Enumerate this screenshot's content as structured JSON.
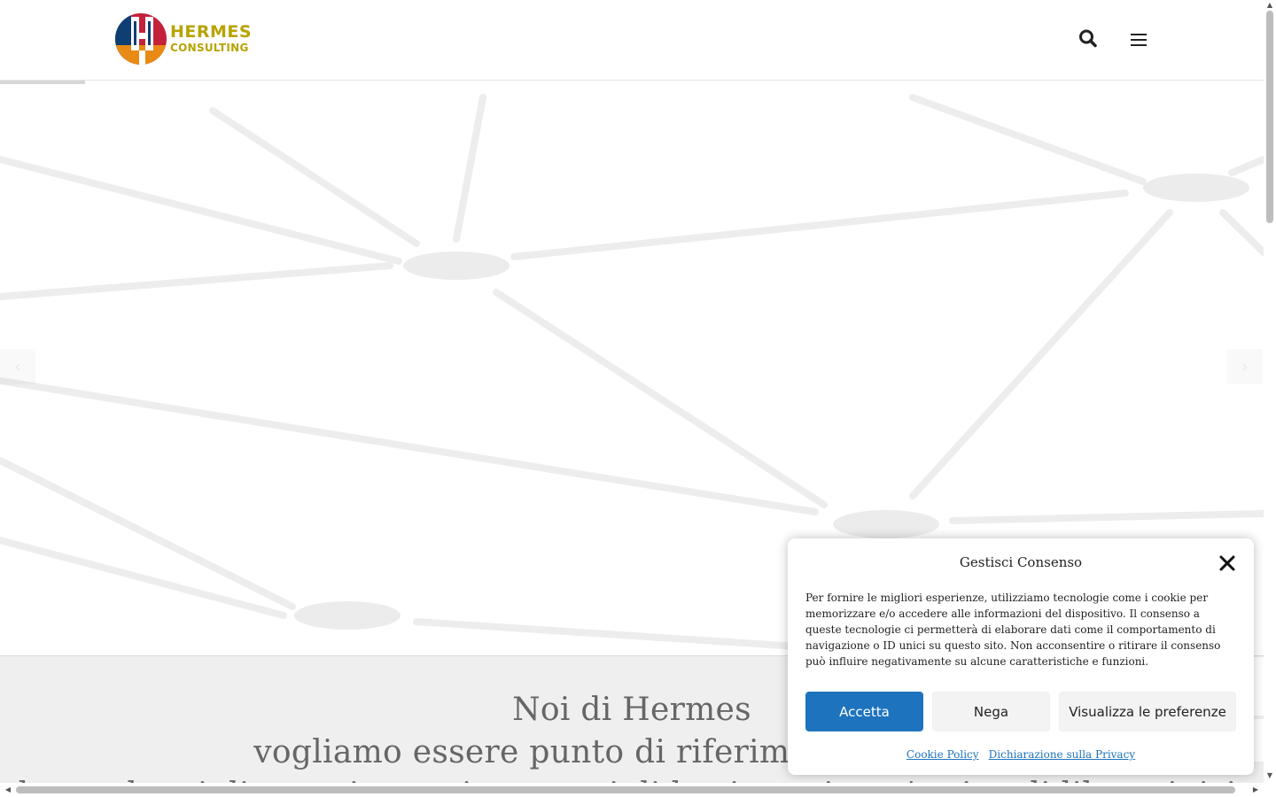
{
  "header": {
    "logo_line1": "HERMES",
    "logo_line2": "CONSULTING",
    "brand_color": "#b7a300",
    "logo_colors": [
      "#c4213b",
      "#0d3f73",
      "#e88a14"
    ],
    "search_icon": "search-icon",
    "menu_icon": "hamburger-menu-icon"
  },
  "hero": {
    "prev_arrow": "‹",
    "next_arrow": "›"
  },
  "intro": {
    "line1": "Noi di Hermes",
    "line2": "vogliamo essere punto di riferimento per ogni",
    "line3": "che vuole migliorare i propri processi di business in un'ottica di libera iniziativa"
  },
  "cookie_banner": {
    "title": "Gestisci Consenso",
    "text": "Per fornire le migliori esperienze, utilizziamo tecnologie come i cookie per memorizzare e/o accedere alle informazioni del dispositivo. Il consenso a queste tecnologie ci permetterà di elaborare dati come il comportamento di navigazione o ID unici su questo sito. Non acconsentire o ritirare il consenso può influire negativamente su alcune caratteristiche e funzioni.",
    "accept_label": "Accetta",
    "deny_label": "Nega",
    "prefs_label": "Visualizza le preferenze",
    "cookie_policy_link": "Cookie Policy",
    "privacy_link": "Dichiarazione sulla Privacy",
    "accent_color": "#1e73be"
  }
}
